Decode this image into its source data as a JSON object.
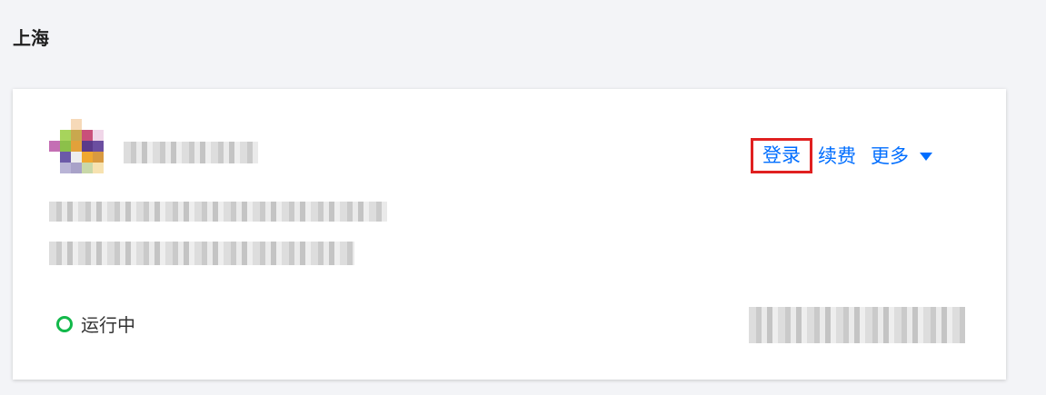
{
  "region": {
    "title": "上海"
  },
  "card": {
    "actions": {
      "login": "登录",
      "renew": "续费",
      "more": "更多"
    },
    "status": {
      "label": "运行中",
      "color": "#12b84a"
    },
    "accent_color": "#006eff",
    "highlight_color": "#e02020"
  },
  "avatar_colors": [
    "#ffffff",
    "#ffffff",
    "#f6d9b8",
    "#ffffff",
    "#ffffff",
    "#ffffff",
    "#a7d45c",
    "#c9a84e",
    "#c9507a",
    "#f0d6e8",
    "#c46fb4",
    "#8cc04a",
    "#e2a13a",
    "#5b3a8a",
    "#6b4ea0",
    "#ffffff",
    "#6b5aa8",
    "#ededed",
    "#f0a830",
    "#d99a40",
    "#ffffff",
    "#b9b4d6",
    "#a8a2c8",
    "#c9d8a8",
    "#f7e2b0"
  ]
}
